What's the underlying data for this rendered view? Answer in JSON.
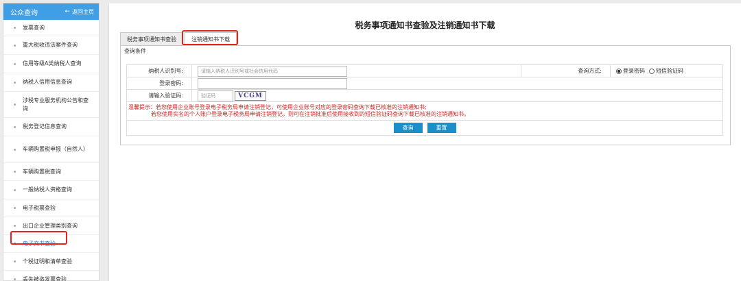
{
  "sidebar": {
    "title": "公众查询",
    "home_label": "返回主页",
    "items": [
      {
        "label": "发票查询"
      },
      {
        "label": "重大税收违法案件查询"
      },
      {
        "label": "信用等级A类纳税人查询"
      },
      {
        "label": "纳税人信用信息查询"
      },
      {
        "label": "涉税专业服务机构公告和查询"
      },
      {
        "label": "税务登记信息查询"
      },
      {
        "label": "车辆购置税申报（自然人）"
      },
      {
        "label": "车辆购置税查询"
      },
      {
        "label": "一般纳税人资格查询"
      },
      {
        "label": "电子税票查验"
      },
      {
        "label": "出口企业管理类别查询"
      },
      {
        "label": "电子文书查验"
      },
      {
        "label": "个税证明和清单查验"
      },
      {
        "label": "丢失被盗发票查验"
      }
    ],
    "active_index": 11
  },
  "main": {
    "title": "税务事项通知书查验及注销通知书下载",
    "tabs": [
      {
        "label": "税务事项通知书查验"
      },
      {
        "label": "注销通知书下载"
      }
    ],
    "active_tab": 1,
    "panel_title": "查询条件",
    "form": {
      "taxpayer_id_label": "纳税人识别号:",
      "taxpayer_id_placeholder": "请输入纳税人识别号或社会信用代码",
      "query_method_label": "查询方式:",
      "option_login_password": "登录密码",
      "option_sms_code": "短信验证码",
      "selected_option": "登录密码",
      "login_password_label": "登录密码:",
      "captcha_label": "请输入验证码:",
      "captcha_placeholder": "验证码",
      "captcha_text": "VCGM"
    },
    "notice_line1": "温馨提示：若您使用企业账号登录电子税务局申请注销登记，可使用企业账号对应的登录密码查询下载已核准的注销通知书;",
    "notice_line2": "若您使用实名的个人账户登录电子税务局申请注销登记，则可在注销批准后使用接收到的短信验证码查询下载已核准的注销通知书。",
    "buttons": {
      "query": "查询",
      "reset": "重置"
    }
  },
  "colors": {
    "sidebar_header": "#3f9ee4",
    "button": "#1a8fc9",
    "highlight": "#e4231c",
    "notice": "#d62020",
    "active_link": "#2f80d1"
  }
}
